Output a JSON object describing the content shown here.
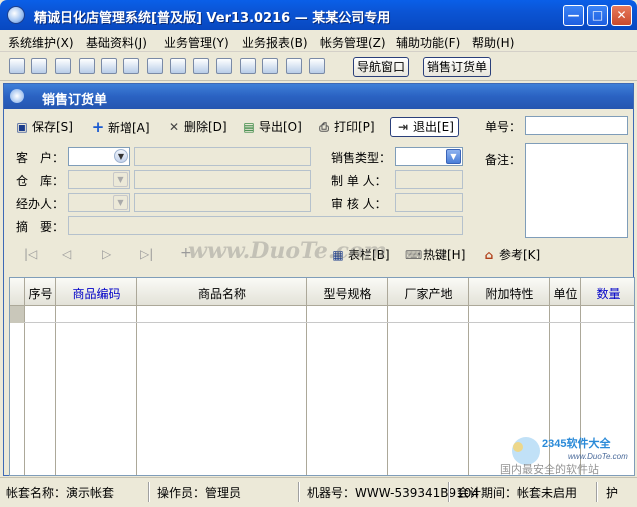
{
  "window": {
    "title": "精诚日化店管理系统[普及版] Ver13.0216 — 某某公司专用",
    "minimize": "—",
    "maximize": "□",
    "close": "✕"
  },
  "menu": [
    "系统维护(X)",
    "基础资料(J)",
    "业务管理(Y)",
    "业务报表(B)",
    "帐务管理(Z)",
    "辅助功能(F)",
    "帮助(H)"
  ],
  "toolbar": {
    "nav_window": "导航窗口",
    "sales_order": "销售订货单"
  },
  "form_window": {
    "title": "销售订货单"
  },
  "actions": {
    "save": "保存[S]",
    "add": "新增[A]",
    "delete": "删除[D]",
    "export": "导出[O]",
    "print": "打印[P]",
    "exit": "退出[E]"
  },
  "fields": {
    "order_no_label": "单号：",
    "customer_label": "客　户：",
    "warehouse_label": "仓　库：",
    "handler_label": "经办人：",
    "summary_label": "摘　要：",
    "sales_type_label": "销售类型：",
    "maker_label": "制 单 人：",
    "reviewer_label": "审 核 人：",
    "remark_label": "备注："
  },
  "grid_toolbar": {
    "first": "|◁",
    "prev": "◁",
    "next": "▷",
    "last": "▷|",
    "add": "+",
    "columns": "表栏[B]",
    "hotkeys": "热键[H]",
    "reference": "参考[K]"
  },
  "watermark": "www.DuoTe.com",
  "grid": {
    "columns": [
      "序号",
      "商品编码",
      "商品名称",
      "型号规格",
      "厂家产地",
      "附加特性",
      "单位",
      "数量"
    ]
  },
  "status": {
    "account": "帐套名称：演示帐套",
    "operator": "操作员：管理员",
    "machine": "机器号：WWW-539341B9104",
    "period": "会计期间：帐套未启用",
    "extra": "护"
  },
  "logo": {
    "brand": "2345软件大全",
    "url": "www.DuoTe.com",
    "slogan": "国内最安全的软件站"
  },
  "colors": {
    "title_bar": "#0B54D4",
    "inner_title": "#2a62c2",
    "blue_header": "#0000c8"
  }
}
